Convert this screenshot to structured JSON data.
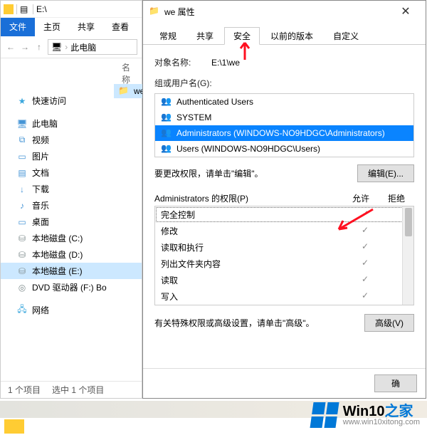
{
  "explorer": {
    "title": "E:\\",
    "ribbon": {
      "file": "文件",
      "home": "主页",
      "share": "共享",
      "view": "查看"
    },
    "addr": {
      "thispc": "此电脑"
    },
    "header": "名称",
    "tree": {
      "quick": "快速访问",
      "thispc": "此电脑",
      "video": "视频",
      "pictures": "图片",
      "documents": "文档",
      "downloads": "下载",
      "music": "音乐",
      "desktop": "桌面",
      "driveC": "本地磁盘 (C:)",
      "driveD": "本地磁盘 (D:)",
      "driveE": "本地磁盘 (E:)",
      "dvd": "DVD 驱动器 (F:) Bo",
      "network": "网络"
    },
    "file_row": "we",
    "status": {
      "count": "1 个项目",
      "selected": "选中 1 个项目"
    }
  },
  "dialog": {
    "title": "we 属性",
    "tabs": {
      "general": "常规",
      "share": "共享",
      "security": "安全",
      "previous": "以前的版本",
      "custom": "自定义"
    },
    "object_label": "对象名称:",
    "object_value": "E:\\1\\we",
    "groups_label": "组或用户名(G):",
    "groups": [
      "Authenticated Users",
      "SYSTEM",
      "Administrators (WINDOWS-NO9HDGC\\Administrators)",
      "Users (WINDOWS-NO9HDGC\\Users)"
    ],
    "edit_hint": "要更改权限，请单击\"编辑\"。",
    "edit_btn": "编辑(E)...",
    "perm_for": "Administrators 的权限(P)",
    "allow": "允许",
    "deny": "拒绝",
    "perms": [
      "完全控制",
      "修改",
      "读取和执行",
      "列出文件夹内容",
      "读取",
      "写入"
    ],
    "adv_hint": "有关特殊权限或高级设置，请单击\"高级\"。",
    "adv_btn": "高级(V)",
    "ok": "确"
  },
  "watermark": {
    "brand_en": "Win10",
    "brand_zh": "之家",
    "url": "www.win10xitong.com"
  }
}
